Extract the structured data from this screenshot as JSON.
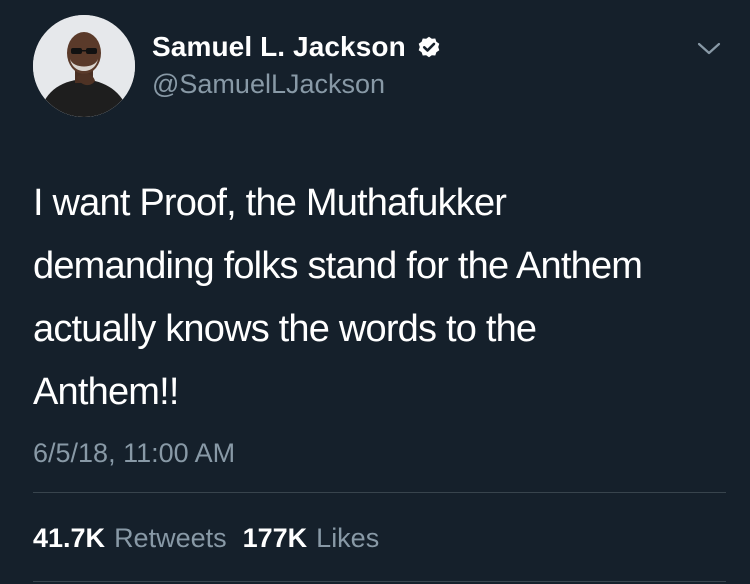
{
  "user": {
    "display_name": "Samuel L. Jackson",
    "handle": "@SamuelLJackson",
    "verified": true
  },
  "tweet": {
    "text": "I want Proof, the Muthafukker\ndemanding folks stand for the Anthem\nactually knows the words to the\nAnthem!!",
    "timestamp": "6/5/18, 11:00 AM"
  },
  "stats": {
    "retweets_count": "41.7K",
    "retweets_label": "Retweets",
    "likes_count": "177K",
    "likes_label": "Likes"
  },
  "icons": {
    "verified": "verified-badge-icon",
    "menu": "chevron-down-icon"
  },
  "colors": {
    "background": "#15202b",
    "text_primary": "#ffffff",
    "text_secondary": "#8899a6",
    "divider": "#38444d"
  }
}
